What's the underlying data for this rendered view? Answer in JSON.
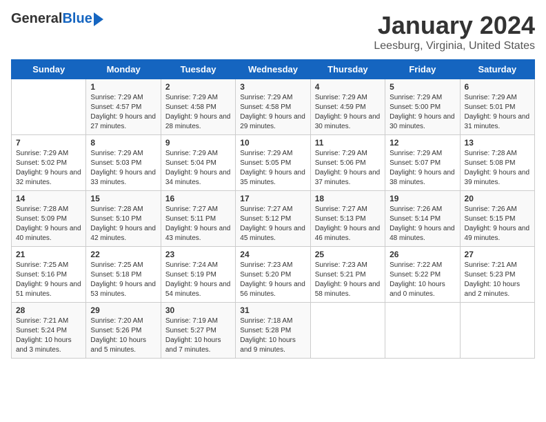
{
  "header": {
    "logo_general": "General",
    "logo_blue": "Blue",
    "month_title": "January 2024",
    "location": "Leesburg, Virginia, United States"
  },
  "calendar": {
    "days_of_week": [
      "Sunday",
      "Monday",
      "Tuesday",
      "Wednesday",
      "Thursday",
      "Friday",
      "Saturday"
    ],
    "weeks": [
      [
        {
          "day": "",
          "sunrise": "",
          "sunset": "",
          "daylight": ""
        },
        {
          "day": "1",
          "sunrise": "Sunrise: 7:29 AM",
          "sunset": "Sunset: 4:57 PM",
          "daylight": "Daylight: 9 hours and 27 minutes."
        },
        {
          "day": "2",
          "sunrise": "Sunrise: 7:29 AM",
          "sunset": "Sunset: 4:58 PM",
          "daylight": "Daylight: 9 hours and 28 minutes."
        },
        {
          "day": "3",
          "sunrise": "Sunrise: 7:29 AM",
          "sunset": "Sunset: 4:58 PM",
          "daylight": "Daylight: 9 hours and 29 minutes."
        },
        {
          "day": "4",
          "sunrise": "Sunrise: 7:29 AM",
          "sunset": "Sunset: 4:59 PM",
          "daylight": "Daylight: 9 hours and 30 minutes."
        },
        {
          "day": "5",
          "sunrise": "Sunrise: 7:29 AM",
          "sunset": "Sunset: 5:00 PM",
          "daylight": "Daylight: 9 hours and 30 minutes."
        },
        {
          "day": "6",
          "sunrise": "Sunrise: 7:29 AM",
          "sunset": "Sunset: 5:01 PM",
          "daylight": "Daylight: 9 hours and 31 minutes."
        }
      ],
      [
        {
          "day": "7",
          "sunrise": "Sunrise: 7:29 AM",
          "sunset": "Sunset: 5:02 PM",
          "daylight": "Daylight: 9 hours and 32 minutes."
        },
        {
          "day": "8",
          "sunrise": "Sunrise: 7:29 AM",
          "sunset": "Sunset: 5:03 PM",
          "daylight": "Daylight: 9 hours and 33 minutes."
        },
        {
          "day": "9",
          "sunrise": "Sunrise: 7:29 AM",
          "sunset": "Sunset: 5:04 PM",
          "daylight": "Daylight: 9 hours and 34 minutes."
        },
        {
          "day": "10",
          "sunrise": "Sunrise: 7:29 AM",
          "sunset": "Sunset: 5:05 PM",
          "daylight": "Daylight: 9 hours and 35 minutes."
        },
        {
          "day": "11",
          "sunrise": "Sunrise: 7:29 AM",
          "sunset": "Sunset: 5:06 PM",
          "daylight": "Daylight: 9 hours and 37 minutes."
        },
        {
          "day": "12",
          "sunrise": "Sunrise: 7:29 AM",
          "sunset": "Sunset: 5:07 PM",
          "daylight": "Daylight: 9 hours and 38 minutes."
        },
        {
          "day": "13",
          "sunrise": "Sunrise: 7:28 AM",
          "sunset": "Sunset: 5:08 PM",
          "daylight": "Daylight: 9 hours and 39 minutes."
        }
      ],
      [
        {
          "day": "14",
          "sunrise": "Sunrise: 7:28 AM",
          "sunset": "Sunset: 5:09 PM",
          "daylight": "Daylight: 9 hours and 40 minutes."
        },
        {
          "day": "15",
          "sunrise": "Sunrise: 7:28 AM",
          "sunset": "Sunset: 5:10 PM",
          "daylight": "Daylight: 9 hours and 42 minutes."
        },
        {
          "day": "16",
          "sunrise": "Sunrise: 7:27 AM",
          "sunset": "Sunset: 5:11 PM",
          "daylight": "Daylight: 9 hours and 43 minutes."
        },
        {
          "day": "17",
          "sunrise": "Sunrise: 7:27 AM",
          "sunset": "Sunset: 5:12 PM",
          "daylight": "Daylight: 9 hours and 45 minutes."
        },
        {
          "day": "18",
          "sunrise": "Sunrise: 7:27 AM",
          "sunset": "Sunset: 5:13 PM",
          "daylight": "Daylight: 9 hours and 46 minutes."
        },
        {
          "day": "19",
          "sunrise": "Sunrise: 7:26 AM",
          "sunset": "Sunset: 5:14 PM",
          "daylight": "Daylight: 9 hours and 48 minutes."
        },
        {
          "day": "20",
          "sunrise": "Sunrise: 7:26 AM",
          "sunset": "Sunset: 5:15 PM",
          "daylight": "Daylight: 9 hours and 49 minutes."
        }
      ],
      [
        {
          "day": "21",
          "sunrise": "Sunrise: 7:25 AM",
          "sunset": "Sunset: 5:16 PM",
          "daylight": "Daylight: 9 hours and 51 minutes."
        },
        {
          "day": "22",
          "sunrise": "Sunrise: 7:25 AM",
          "sunset": "Sunset: 5:18 PM",
          "daylight": "Daylight: 9 hours and 53 minutes."
        },
        {
          "day": "23",
          "sunrise": "Sunrise: 7:24 AM",
          "sunset": "Sunset: 5:19 PM",
          "daylight": "Daylight: 9 hours and 54 minutes."
        },
        {
          "day": "24",
          "sunrise": "Sunrise: 7:23 AM",
          "sunset": "Sunset: 5:20 PM",
          "daylight": "Daylight: 9 hours and 56 minutes."
        },
        {
          "day": "25",
          "sunrise": "Sunrise: 7:23 AM",
          "sunset": "Sunset: 5:21 PM",
          "daylight": "Daylight: 9 hours and 58 minutes."
        },
        {
          "day": "26",
          "sunrise": "Sunrise: 7:22 AM",
          "sunset": "Sunset: 5:22 PM",
          "daylight": "Daylight: 10 hours and 0 minutes."
        },
        {
          "day": "27",
          "sunrise": "Sunrise: 7:21 AM",
          "sunset": "Sunset: 5:23 PM",
          "daylight": "Daylight: 10 hours and 2 minutes."
        }
      ],
      [
        {
          "day": "28",
          "sunrise": "Sunrise: 7:21 AM",
          "sunset": "Sunset: 5:24 PM",
          "daylight": "Daylight: 10 hours and 3 minutes."
        },
        {
          "day": "29",
          "sunrise": "Sunrise: 7:20 AM",
          "sunset": "Sunset: 5:26 PM",
          "daylight": "Daylight: 10 hours and 5 minutes."
        },
        {
          "day": "30",
          "sunrise": "Sunrise: 7:19 AM",
          "sunset": "Sunset: 5:27 PM",
          "daylight": "Daylight: 10 hours and 7 minutes."
        },
        {
          "day": "31",
          "sunrise": "Sunrise: 7:18 AM",
          "sunset": "Sunset: 5:28 PM",
          "daylight": "Daylight: 10 hours and 9 minutes."
        },
        {
          "day": "",
          "sunrise": "",
          "sunset": "",
          "daylight": ""
        },
        {
          "day": "",
          "sunrise": "",
          "sunset": "",
          "daylight": ""
        },
        {
          "day": "",
          "sunrise": "",
          "sunset": "",
          "daylight": ""
        }
      ]
    ]
  }
}
